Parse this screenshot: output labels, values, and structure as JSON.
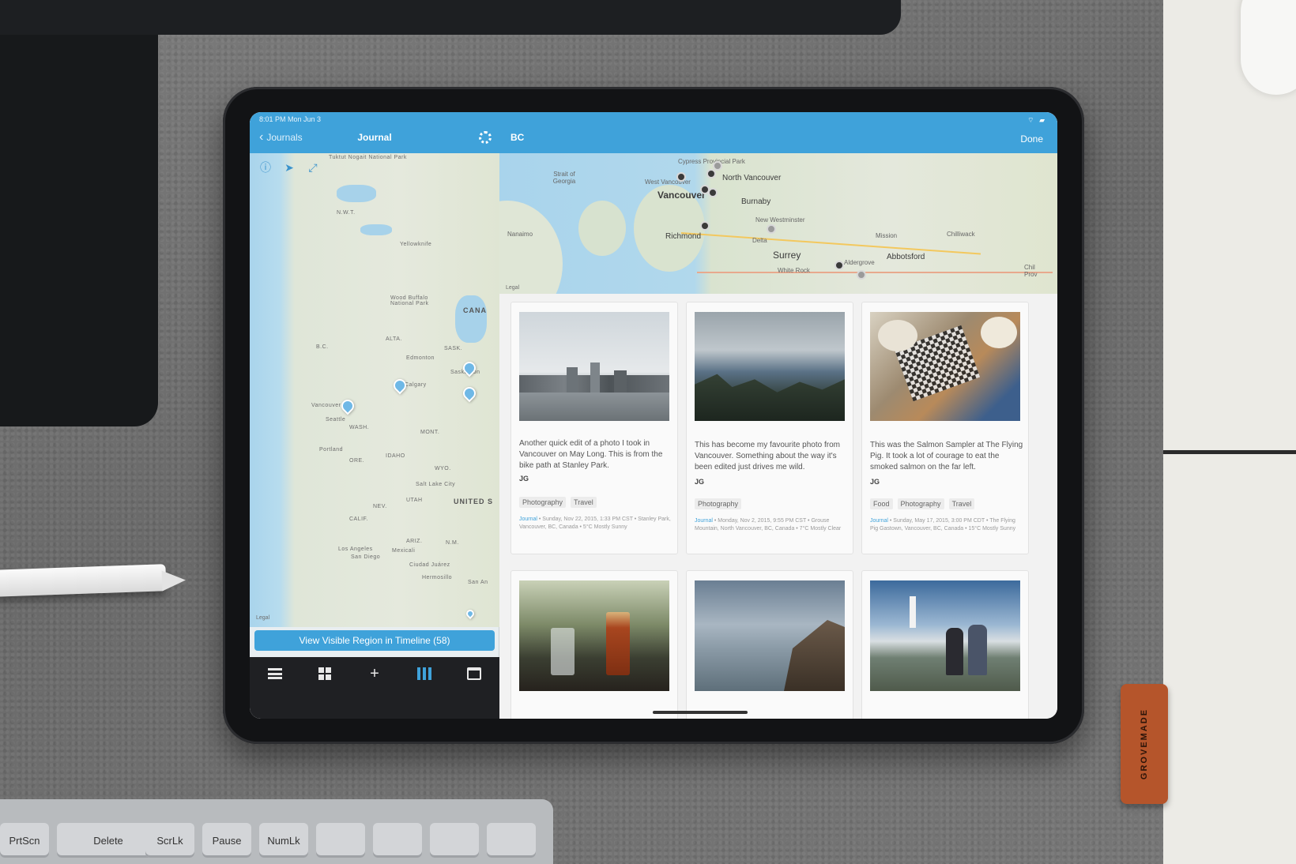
{
  "status_bar": {
    "time_date": "8:01 PM   Mon Jun 3"
  },
  "left_nav": {
    "back_label": "Journals",
    "title": "Journal"
  },
  "right_nav": {
    "title": "BC",
    "done_label": "Done"
  },
  "left_map": {
    "labels": [
      "Tuktut Nogait National Park",
      "N.W.T.",
      "Yellowknife",
      "Wood Buffalo National Park",
      "CANA",
      "ALTA.",
      "SASK.",
      "B.C.",
      "Edmonton",
      "Calgary",
      "Saskatoon",
      "Vancouver",
      "Seattle",
      "WASH.",
      "MONT.",
      "Portland",
      "ORE.",
      "IDAHO",
      "WYO.",
      "Salt Lake City",
      "UTAH",
      "UNITED S",
      "NEV.",
      "CALIF.",
      "Los Angeles",
      "San Diego",
      "ARIZ.",
      "Mexicali",
      "N.M.",
      "Ciudad Juárez",
      "Hermosillo",
      "San An"
    ],
    "legal": "Legal"
  },
  "region_button": {
    "label": "View Visible Region in Timeline (58)"
  },
  "tabbar": {
    "items": [
      "list-icon",
      "grid-icon",
      "add-icon",
      "map-icon",
      "calendar-icon"
    ],
    "active": "map-icon"
  },
  "right_map": {
    "labels": {
      "strait": "Strait of Georgia",
      "cypress": "Cypress Provincial Park",
      "west_vancouver": "West Vancouver",
      "north_vancouver": "North Vancouver",
      "vancouver": "Vancouver",
      "burnaby": "Burnaby",
      "new_westminster": "New Westminster",
      "nanaimo": "Nanaimo",
      "richmond": "Richmond",
      "delta": "Delta",
      "surrey": "Surrey",
      "white_rock": "White Rock",
      "aldergrove": "Aldergrove",
      "abbotsford": "Abbotsford",
      "mission": "Mission",
      "chilliwack": "Chilliwack",
      "chilliwack_prov": "Chil Prov"
    },
    "legal": "Legal"
  },
  "entries": [
    {
      "text": "Another quick edit of a photo I took in Vancouver on May Long. This is from the bike path at Stanley Park.",
      "author": "JG",
      "tags": [
        "Photography",
        "Travel"
      ],
      "journal": "Journal",
      "meta": " • Sunday, Nov 22, 2015, 1:33 PM CST • Stanley Park, Vancouver, BC, Canada • 5°C Mostly Sunny"
    },
    {
      "text": "This has become my favourite photo from Vancouver. Something about the way it's been edited just drives me wild.",
      "author": "JG",
      "tags": [
        "Photography"
      ],
      "journal": "Journal",
      "meta": " • Monday, Nov 2, 2015, 9:55 PM CST • Grouse Mountain, North Vancouver, BC, Canada • 7°C Mostly Clear"
    },
    {
      "text": "This was the Salmon Sampler at The Flying Pig. It took a lot of courage to eat the smoked salmon on the far left.",
      "author": "JG",
      "tags": [
        "Food",
        "Photography",
        "Travel"
      ],
      "journal": "Journal",
      "meta": " • Sunday, May 17, 2015, 3:00 PM CDT • The Flying Pig Gastown, Vancouver, BC, Canada • 15°C Mostly Sunny"
    }
  ],
  "desk": {
    "leather_brand": "GROVEMADE",
    "keys": [
      "PrtScn",
      "Delete",
      "ScrLk",
      "Pause",
      "NumLk"
    ]
  },
  "colors": {
    "accent": "#3fa2da",
    "tabbar": "#1f2023"
  }
}
